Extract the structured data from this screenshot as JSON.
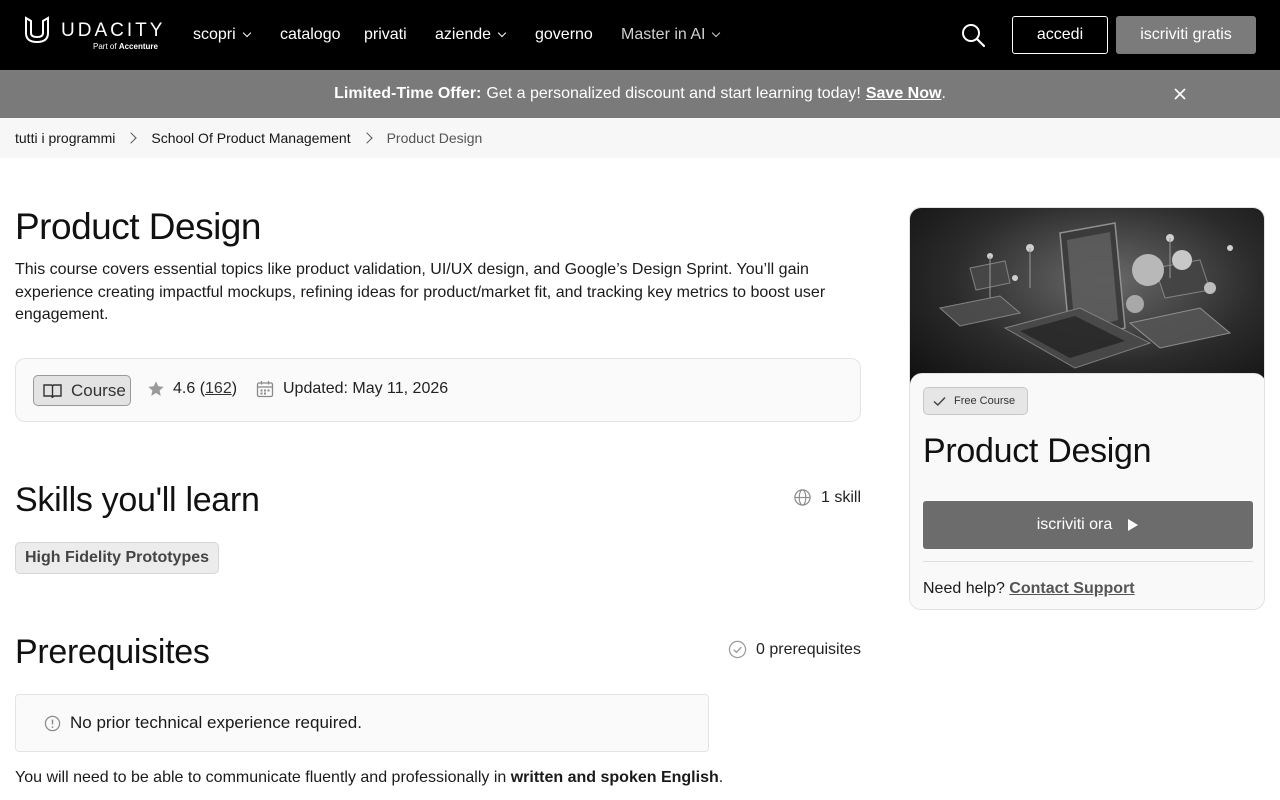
{
  "nav": {
    "logo_word": "UDACITY",
    "logo_sub_prefix": "Part of",
    "logo_sub_brand": "Accenture",
    "items": [
      {
        "label": "scopri",
        "dropdown": true
      },
      {
        "label": "catalogo",
        "dropdown": false
      },
      {
        "label": "privati",
        "dropdown": false
      },
      {
        "label": "aziende",
        "dropdown": true
      },
      {
        "label": "governo",
        "dropdown": false
      },
      {
        "label": "Master in AI",
        "dropdown": true
      }
    ],
    "login_label": "accedi",
    "signup_label": "iscriviti gratis"
  },
  "promo": {
    "bold": "Limited-Time Offer:",
    "text": "Get a personalized discount and start learning today!",
    "link": "Save Now",
    "suffix": "."
  },
  "breadcrumb": [
    "tutti i programmi",
    "School Of Product Management",
    "Product Design"
  ],
  "course": {
    "title": "Product Design",
    "description": "This course covers essential topics like product validation, UI/UX design, and Google’s Design Sprint. You’ll gain experience creating impactful mockups, refining ideas for product/market fit, and tracking key metrics to boost user engagement.",
    "type": "Course",
    "rating": "4.6",
    "reviews": "162",
    "updated": "Updated: May 11, 2026"
  },
  "skills": {
    "heading": "Skills you'll learn",
    "count": "1 skill",
    "items": [
      "High Fidelity Prototypes"
    ]
  },
  "prerequisites": {
    "heading": "Prerequisites",
    "count": "0 prerequisites",
    "box_text": "No prior technical experience required.",
    "note_prefix": "You will need to be able to communicate fluently and professionally in",
    "note_bold": "written and spoken English",
    "note_suffix": "."
  },
  "card": {
    "badge": "Free Course",
    "title": "Product Design",
    "enroll_label": "iscriviti ora",
    "help_text": "Need help?",
    "help_link": "Contact Support"
  }
}
